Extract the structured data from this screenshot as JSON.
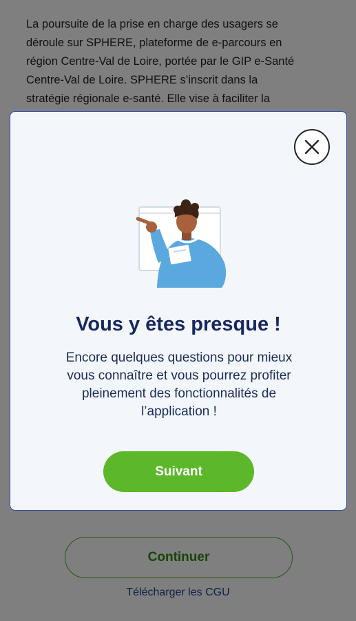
{
  "background": {
    "intro_lines": [
      "La poursuite de la prise en charge des usagers se",
      "déroule sur SPHERE, plateforme de e-parcours en",
      "région Centre-Val de Loire, portée par le GIP e-Santé",
      "Centre-Val de Loire. SPHERE s’inscrit dans la",
      "stratégie régionale e-santé. Elle vise à faciliter la"
    ],
    "continue_label": "Continuer",
    "cgu_link": "Télécharger les CGU"
  },
  "modal": {
    "close_icon": "close-icon",
    "illustration": "person-pointing-illustration",
    "title": "Vous y êtes presque !",
    "body_lines": [
      "Encore quelques questions pour mieux",
      "vous connaître et vous pourrez profiter",
      "pleinement des fonctionnalités de",
      "l’application !"
    ],
    "next_label": "Suivant"
  },
  "colors": {
    "accent_green": "#5cb82a",
    "title_navy": "#17275e",
    "link_blue": "#1b3f8e"
  }
}
